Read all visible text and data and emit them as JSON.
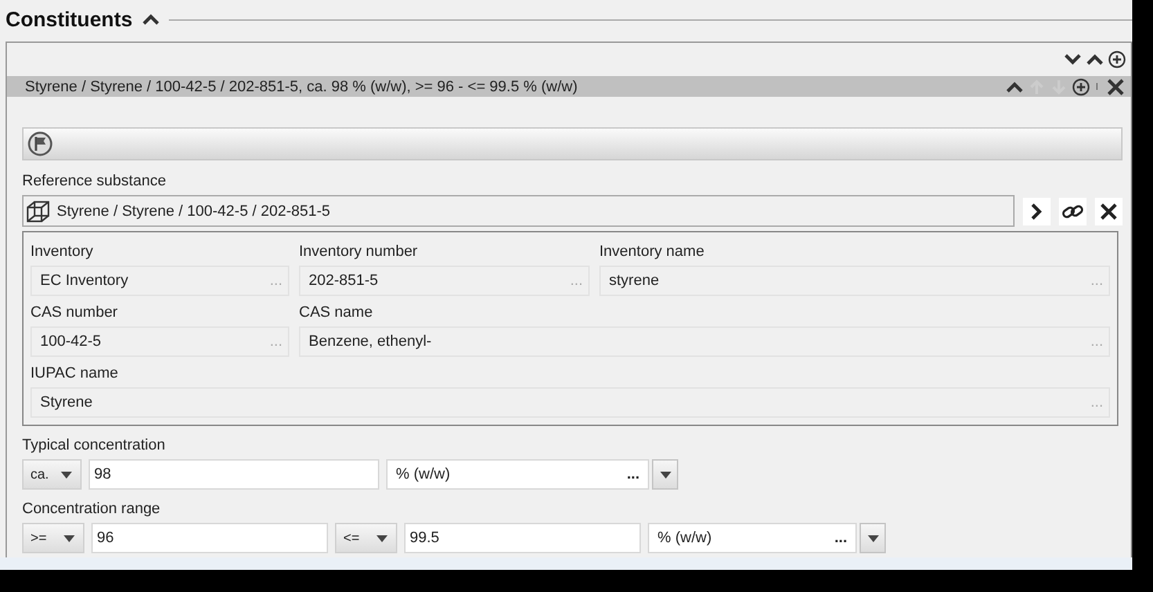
{
  "section": {
    "title": "Constituents",
    "expanded": true
  },
  "list_actions": [
    {
      "kind": "down",
      "disabled": false
    },
    {
      "kind": "up",
      "disabled": false
    },
    {
      "kind": "add"
    }
  ],
  "item": {
    "summary": "Styrene / Styrene / 100-42-5 / 202-851-5, ca. 98 % (w/w), >= 96 - <= 99.5 % (w/w)",
    "actions": [
      {
        "kind": "collapse"
      },
      {
        "kind": "up",
        "disabled": true
      },
      {
        "kind": "down",
        "disabled": true
      },
      {
        "kind": "add"
      },
      {
        "kind": "separator"
      },
      {
        "kind": "delete"
      }
    ]
  },
  "reference_substance": {
    "label": "Reference substance",
    "value": "Styrene / Styrene / 100-42-5 / 202-851-5"
  },
  "identity_rows": [
    [
      {
        "label": "Inventory",
        "value": "EC Inventory",
        "more": "..."
      },
      {
        "label": "Inventory number",
        "value": "202-851-5",
        "more": "..."
      },
      {
        "label": "Inventory name",
        "value": "styrene",
        "more": "..."
      }
    ],
    [
      {
        "label": "CAS number",
        "value": "100-42-5",
        "more": "..."
      },
      {
        "label": "CAS name",
        "value": "Benzene, ethenyl-",
        "more": "..."
      }
    ],
    [
      {
        "label": "IUPAC name",
        "value": "Styrene",
        "more": "..."
      }
    ]
  ],
  "typical_concentration": {
    "label": "Typical concentration",
    "qualifier": "ca.",
    "value": "98",
    "unit": "% (w/w)",
    "more": "..."
  },
  "concentration_range": {
    "label": "Concentration range",
    "lower_qualifier": ">=",
    "lower_value": "96",
    "upper_qualifier": "<=",
    "upper_value": "99.5",
    "unit": "% (w/w)",
    "more": "..."
  }
}
